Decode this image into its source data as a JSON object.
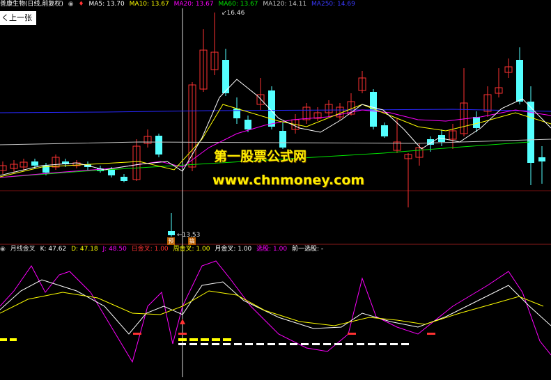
{
  "window": {
    "title": "善康生物(日线,前复权)",
    "prev_button": "上一张"
  },
  "colors": {
    "bg": "#000000",
    "up": "#ff3232",
    "down": "#54ffff",
    "ma5": "#ffffff",
    "ma10": "#ffff00",
    "ma20": "#ff00ff",
    "ma60": "#00e600",
    "ma120": "#c8c8c8",
    "ma250": "#2828ff",
    "k": "#ffffff",
    "d": "#ffff00",
    "j": "#ff00ff"
  },
  "main_legend": {
    "ma5": "MA5: 13.70",
    "ma10": "MA10: 13.67",
    "ma20": "MA20: 13.67",
    "ma60": "MA60: 13.67",
    "ma120": "MA120: 14.11",
    "ma250": "MA250: 14.69"
  },
  "price_labels": {
    "high": "16.46",
    "low": "13.53"
  },
  "markers": {
    "m1": "预",
    "m2": "搞"
  },
  "watermark": {
    "line1": "第一股票公式网",
    "line2": "www.chnmoney.com"
  },
  "indicator_legend": {
    "name": "月线金叉",
    "k": "K: 47.62",
    "d": "D: 47.18",
    "j": "J: 48.50",
    "daily_cross": "日金叉: 1.00",
    "weekly_cross": "周金叉: 1.00",
    "monthly_cross": "月金叉: 1.00",
    "select": "选股: 1.00",
    "prev_select": "前一选股: -"
  }
}
